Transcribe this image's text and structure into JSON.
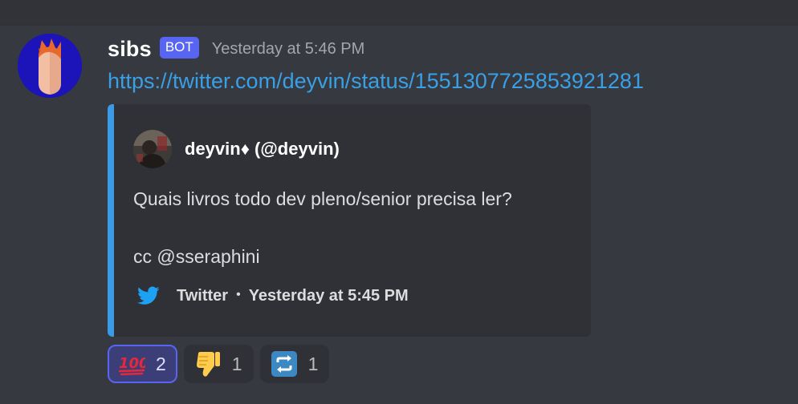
{
  "message": {
    "username": "sibs",
    "bot_tag": "BOT",
    "timestamp": "Yesterday at 5:46 PM",
    "link_text": "https://twitter.com/deyvin/status/1551307725853921281",
    "avatar_icon": "fox-avatar-icon"
  },
  "embed": {
    "accent_color": "#3a9ae6",
    "author": "deyvin♦ (@deyvin)",
    "description_line1": "Quais livros todo dev pleno/senior precisa ler?",
    "description_line2": "cc @sseraphini",
    "footer_icon": "twitter-bird-icon",
    "footer_source": "Twitter",
    "footer_separator": "•",
    "footer_timestamp": "Yesterday at 5:45 PM"
  },
  "reactions": [
    {
      "emoji": "hundred-points-emoji",
      "count": "2",
      "active": true
    },
    {
      "emoji": "thumbs-down-emoji",
      "count": "1",
      "active": false
    },
    {
      "emoji": "repeat-button-emoji",
      "count": "1",
      "active": false
    }
  ],
  "colors": {
    "background": "#36393f",
    "embed_background": "#2f3136",
    "link": "#3aa0e6",
    "bot_tag": "#5865f2",
    "reaction_active_border": "#5865f2"
  }
}
